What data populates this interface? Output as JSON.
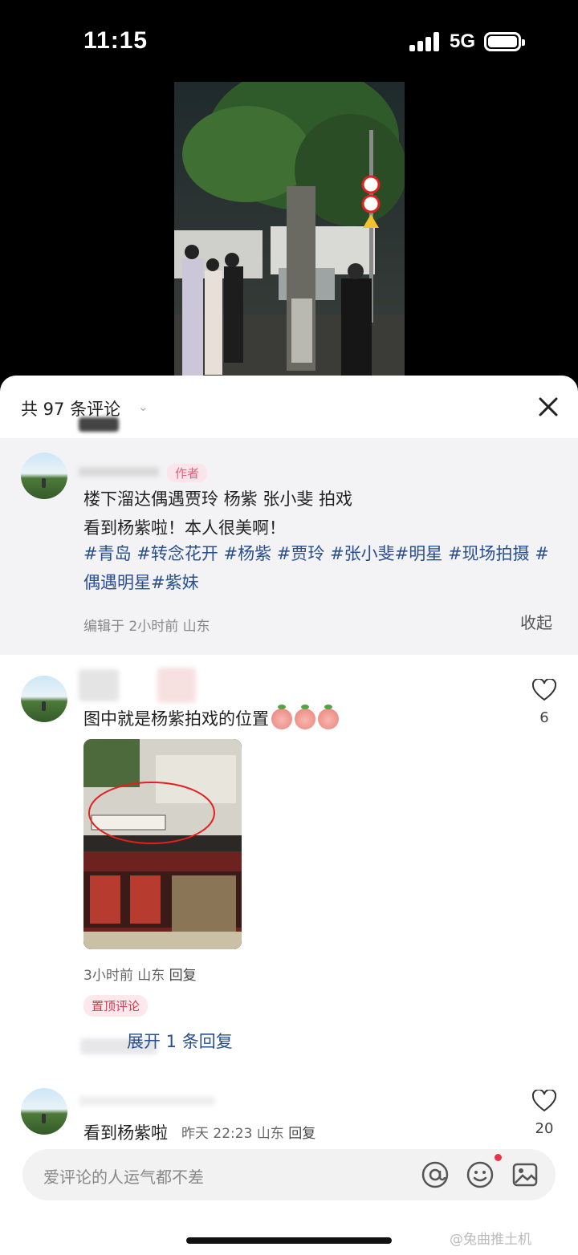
{
  "status": {
    "time": "11:15",
    "network": "5G"
  },
  "sheet": {
    "count_label": "共 97 条评论",
    "close_icon": "close-icon"
  },
  "post": {
    "author_tag": "作者",
    "line1": "楼下溜达偶遇贾玲 杨紫 张小斐 拍戏",
    "line2": "看到杨紫啦！本人很美啊！",
    "hashtags": "#青岛 #转念花开 #杨紫 #贾玲 #张小斐#明星 #现场拍摄 #偶遇明星#紫妹",
    "edit_time": "编辑于  2小时前 山东",
    "collapse": "收起"
  },
  "comments": [
    {
      "text": "图中就是杨紫拍戏的位置",
      "likes": "6",
      "time": "3小时前 山东",
      "reply": "回复",
      "pinned": "置顶评论",
      "expand": "展开 1 条回复"
    },
    {
      "text": "看到杨紫啦",
      "time": "昨天 22:23 山东",
      "reply": "回复",
      "likes": "20"
    }
  ],
  "input": {
    "placeholder": "爱评论的人运气都不差",
    "icons": [
      "at-icon",
      "emoji-icon",
      "image-icon"
    ]
  },
  "watermark": "@兔曲推土机"
}
